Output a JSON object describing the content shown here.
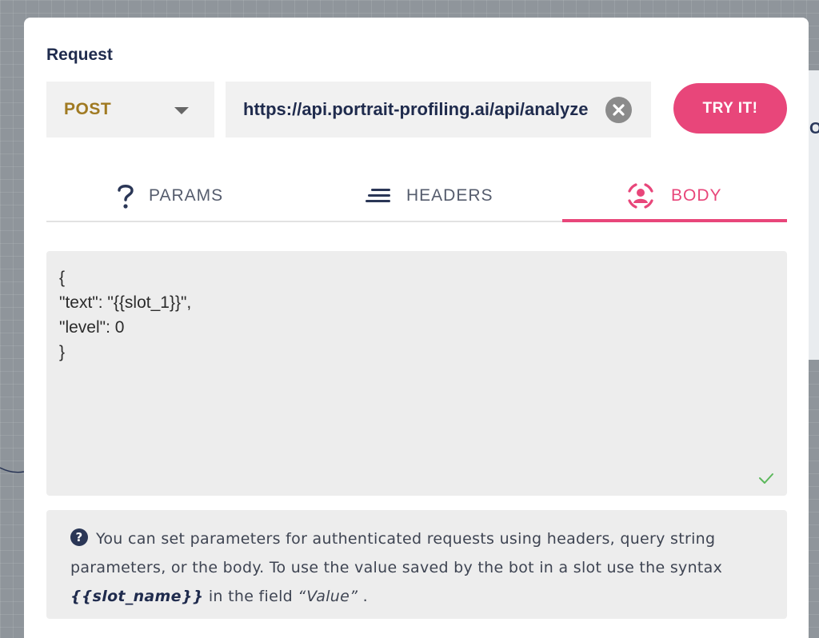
{
  "request": {
    "title": "Request",
    "method": "POST",
    "url": "https://api.portrait-profiling.ai/api/analyze",
    "try_label": "TRY IT!"
  },
  "tabs": [
    {
      "label": "PARAMS",
      "icon": "question-icon",
      "active": false
    },
    {
      "label": "HEADERS",
      "icon": "lines-icon",
      "active": false
    },
    {
      "label": "BODY",
      "icon": "person-focus-icon",
      "active": true
    }
  ],
  "body_editor": {
    "content": "{\n\"text\": \"{{slot_1}}\",\n\"level\": 0\n}",
    "valid": true
  },
  "info": {
    "text_before": "You can set parameters for authenticated requests using headers, query string parameters, or the body. To use the value saved by the bot in a slot use the syntax ",
    "syntax": "{{slot_name}}",
    "text_middle": " in the field ",
    "value_word": "“Value”",
    "text_after": " ."
  },
  "colors": {
    "accent": "#e8467a",
    "title": "#1f2b4d",
    "method": "#a07a22",
    "side_panel_border": "#2f8fb0"
  }
}
